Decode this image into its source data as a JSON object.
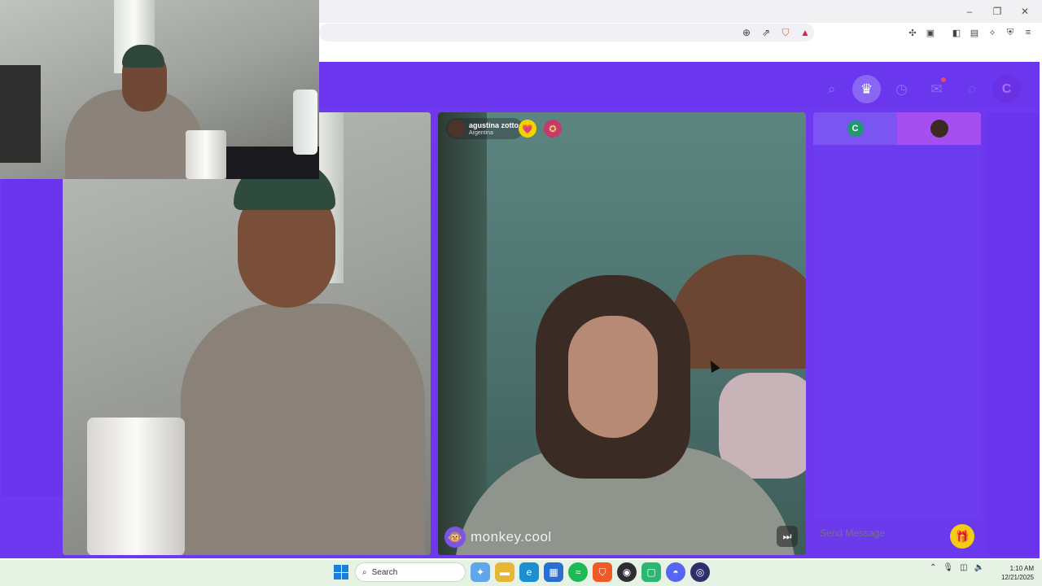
{
  "window": {
    "controls": {
      "minimize": "–",
      "restore": "❐",
      "close": "✕"
    }
  },
  "address_bar": {
    "icons": [
      "zoom-icon",
      "share-icon",
      "brave-shield-icon",
      "brave-rewards-icon"
    ],
    "extensions": [
      "extensions-icon",
      "tab-search-icon",
      "sidebar-icon",
      "wallet-icon",
      "leo-ai-icon",
      "vpn-icon",
      "menu-icon"
    ]
  },
  "site_nav": {
    "avatar_letter": "C",
    "has_notification": true
  },
  "remote_peer": {
    "name": "agustina zotto",
    "country": "Argentina",
    "badge_heart": "💗",
    "badge_flag": "✪"
  },
  "video": {
    "watermark_logo": "🐵",
    "watermark_text": "monkey.cool",
    "next_button": "⏭"
  },
  "chat": {
    "tab_one_letter": "C",
    "input_placeholder": "Send Message",
    "gift_icon": "🎁"
  },
  "taskbar": {
    "search_label": "Search",
    "clock_time": "1:10 AM",
    "clock_date": "12/21/2025"
  },
  "colors": {
    "brand_purple": "#6d38f0",
    "chat_tab_active": "#a64ff0",
    "gift_yellow": "#f5cc12",
    "badge_yellow": "#f3d400"
  }
}
